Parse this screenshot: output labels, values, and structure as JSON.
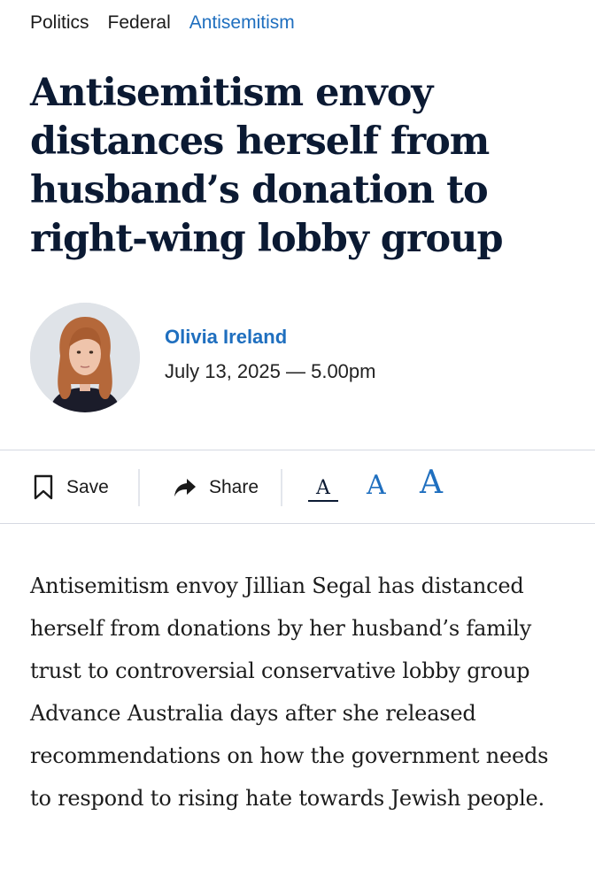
{
  "breadcrumb": {
    "items": [
      {
        "label": "Politics"
      },
      {
        "label": "Federal"
      },
      {
        "label": "Antisemitism"
      }
    ]
  },
  "article": {
    "headline": "Antisemitism envoy distances herself from husband’s donation to right-wing lobby group",
    "author": "Olivia Ireland",
    "date": "July 13, 2025 — 5.00pm",
    "body": "Antisemitism envoy Jillian Segal has distanced herself from donations by her husband’s family trust to controversial conservative lobby group Advance Australia days after she released recommendations on how the government needs to respond to rising hate towards Jewish people."
  },
  "toolbar": {
    "save_label": "Save",
    "share_label": "Share",
    "font_small_label": "A",
    "font_medium_label": "A",
    "font_large_label": "A",
    "save_icon": "bookmark-icon",
    "share_icon": "share-arrow-icon"
  },
  "colors": {
    "accent": "#1f6fbf",
    "headline": "#0b1a33",
    "divider": "#d5d9e2"
  }
}
